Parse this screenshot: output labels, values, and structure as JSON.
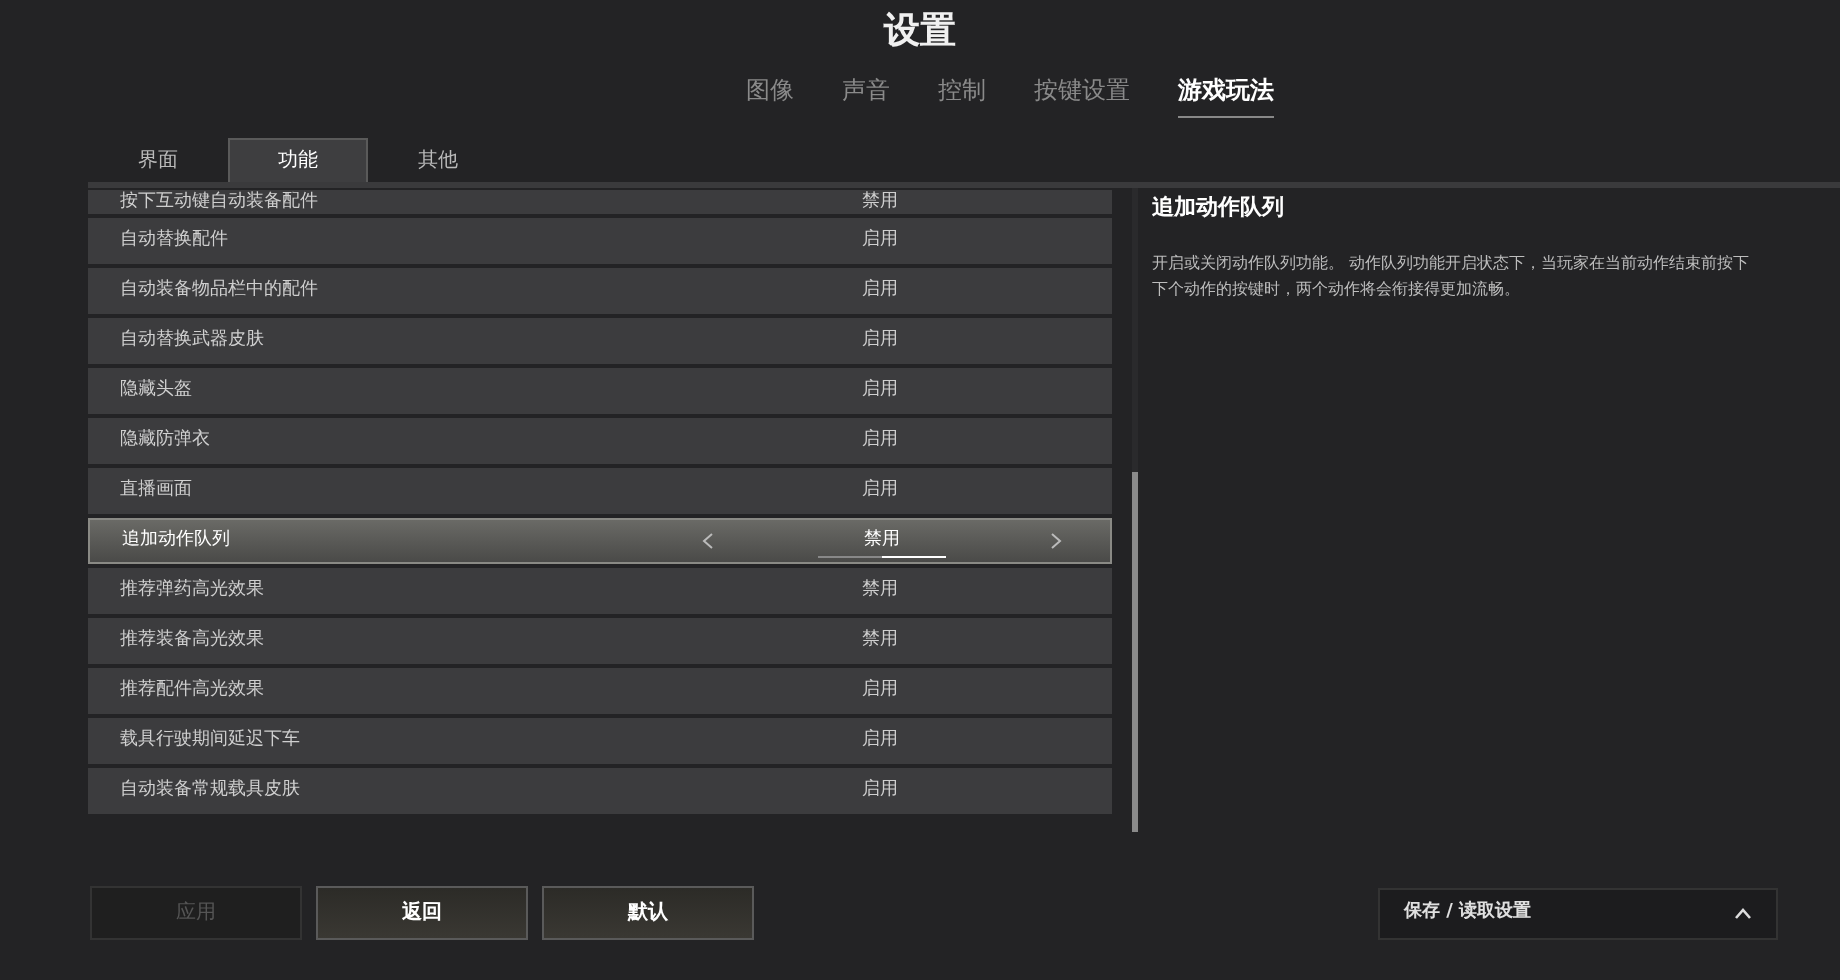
{
  "title": "设置",
  "tabs": [
    {
      "label": "图像",
      "selected": false
    },
    {
      "label": "声音",
      "selected": false
    },
    {
      "label": "控制",
      "selected": false
    },
    {
      "label": "按键设置",
      "selected": false
    },
    {
      "label": "游戏玩法",
      "selected": true
    }
  ],
  "subtabs": [
    {
      "label": "界面",
      "selected": false
    },
    {
      "label": "功能",
      "selected": true
    },
    {
      "label": "其他",
      "selected": false
    }
  ],
  "settings": [
    {
      "name": "按下互动键自动装备配件",
      "value": "禁用",
      "selected": false
    },
    {
      "name": "自动替换配件",
      "value": "启用",
      "selected": false
    },
    {
      "name": "自动装备物品栏中的配件",
      "value": "启用",
      "selected": false
    },
    {
      "name": "自动替换武器皮肤",
      "value": "启用",
      "selected": false
    },
    {
      "name": "隐藏头盔",
      "value": "启用",
      "selected": false
    },
    {
      "name": "隐藏防弹衣",
      "value": "启用",
      "selected": false
    },
    {
      "name": "直播画面",
      "value": "启用",
      "selected": false
    },
    {
      "name": "追加动作队列",
      "value": "禁用",
      "selected": true
    },
    {
      "name": "推荐弹药高光效果",
      "value": "禁用",
      "selected": false
    },
    {
      "name": "推荐装备高光效果",
      "value": "禁用",
      "selected": false
    },
    {
      "name": "推荐配件高光效果",
      "value": "启用",
      "selected": false
    },
    {
      "name": "载具行驶期间延迟下车",
      "value": "启用",
      "selected": false
    },
    {
      "name": "自动装备常规载具皮肤",
      "value": "启用",
      "selected": false
    }
  ],
  "detail": {
    "title": "追加动作队列",
    "description": "开启或关闭动作队列功能。 动作队列功能开启状态下，当玩家在当前动作结束前按下下个动作的按键时，两个动作将会衔接得更加流畅。"
  },
  "buttons": [
    {
      "label": "应用",
      "disabled": true
    },
    {
      "label": "返回",
      "disabled": false
    },
    {
      "label": "默认",
      "disabled": false
    }
  ],
  "save_load": {
    "label": "保存 / 读取设置",
    "expanded": false
  }
}
